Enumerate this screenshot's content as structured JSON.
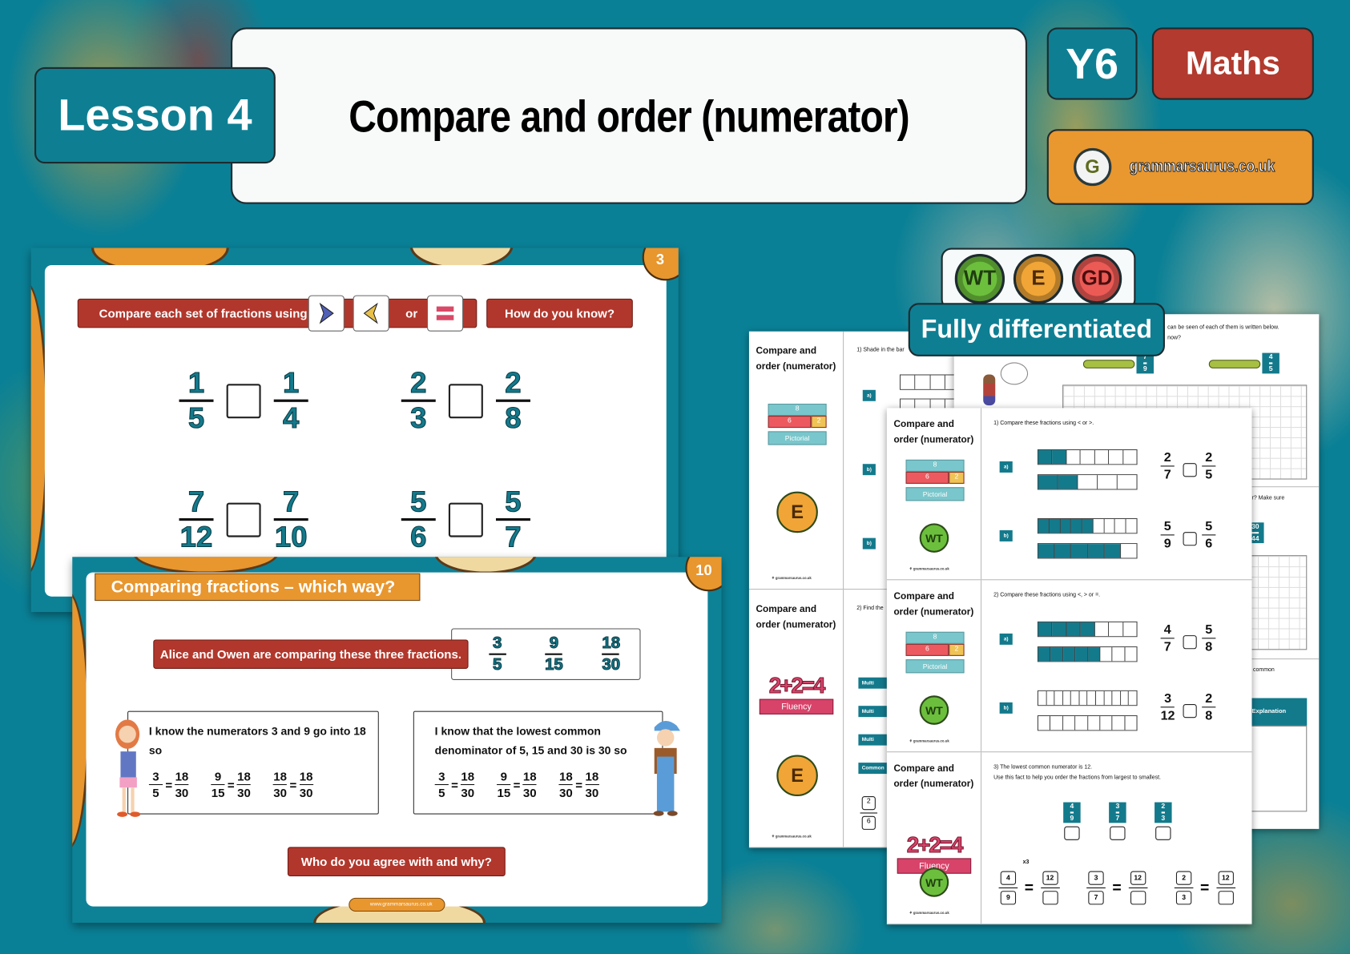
{
  "header": {
    "lesson": "Lesson 4",
    "title": "Compare and order (numerator)",
    "year": "Y6",
    "subject": "Maths",
    "brand": "grammarsaurus.co.uk"
  },
  "colors": {
    "teal": "#0d8297",
    "red": "#b1372c",
    "orange": "#e8962e",
    "white": "#ffffff",
    "wt": "#6cbf3c",
    "e": "#f0a536",
    "gd": "#ec5a55"
  },
  "slide3": {
    "number": "3",
    "instruction": "Compare each set of fractions using",
    "or": "or",
    "symbols": [
      "greater-than-icon",
      "less-than-icon",
      "equals-icon"
    ],
    "prompt": "How do you know?",
    "pairs": [
      {
        "a": [
          "1",
          "5"
        ],
        "b": [
          "1",
          "4"
        ]
      },
      {
        "a": [
          "2",
          "3"
        ],
        "b": [
          "2",
          "8"
        ]
      },
      {
        "a": [
          "7",
          "12"
        ],
        "b": [
          "7",
          "10"
        ]
      },
      {
        "a": [
          "5",
          "6"
        ],
        "b": [
          "5",
          "7"
        ]
      }
    ]
  },
  "slide10": {
    "number": "10",
    "title": "Comparing fractions – which way?",
    "banner": "Alice and Owen are comparing these three fractions.",
    "fractions": [
      [
        "3",
        "5"
      ],
      [
        "9",
        "15"
      ],
      [
        "18",
        "30"
      ]
    ],
    "alice": {
      "text": "I know the numerators 3 and 9 go into 18 so",
      "equations": [
        [
          [
            "3",
            "5"
          ],
          [
            "18",
            "30"
          ]
        ],
        [
          [
            "9",
            "15"
          ],
          [
            "18",
            "30"
          ]
        ],
        [
          [
            "18",
            "30"
          ],
          [
            "18",
            "30"
          ]
        ]
      ]
    },
    "owen": {
      "text": "I know that the lowest common denominator of 5, 15 and 30 is 30 so",
      "equations": [
        [
          [
            "3",
            "5"
          ],
          [
            "18",
            "30"
          ]
        ],
        [
          [
            "9",
            "15"
          ],
          [
            "18",
            "30"
          ]
        ],
        [
          [
            "18",
            "30"
          ],
          [
            "18",
            "30"
          ]
        ]
      ]
    },
    "question": "Who do you agree with and why?",
    "footer": "www.grammarsaurus.co.uk"
  },
  "badges": {
    "levels": [
      "WT",
      "E",
      "GD"
    ],
    "label": "Fully differentiated"
  },
  "worksheet_back_left": {
    "sections": [
      {
        "title": "Compare and order (numerator)",
        "model": {
          "total": "8",
          "parts": [
            "6",
            "2"
          ],
          "label": "Pictorial"
        },
        "level": "E",
        "question": "1) Shade in the bar",
        "labels": [
          "a)",
          "b)",
          "b)"
        ],
        "footer": "grammarsaurus.co.uk"
      },
      {
        "title": "Compare and order (numerator)",
        "fluency": {
          "equation": "2+2=4",
          "label": "Fluency"
        },
        "level": "E",
        "question": "2) Find the",
        "buttons": [
          "Multi",
          "Multi",
          "Multi",
          "Common"
        ],
        "fraction": [
          "2",
          "6"
        ],
        "footer": "grammarsaurus.co.uk"
      }
    ]
  },
  "worksheet_back_right": {
    "line1": "can be seen of each of them is written below.",
    "line2": "now?",
    "snake_fractions": [
      [
        "7",
        "9"
      ],
      [
        "4",
        "5"
      ]
    ],
    "line3": "r? Make sure",
    "card": [
      "30",
      "44"
    ],
    "line4": "e common",
    "table_header": "Explanation"
  },
  "worksheet_front": {
    "sections": [
      {
        "title": "Compare and order (numerator)",
        "model": {
          "total": "8",
          "parts": [
            "6",
            "2"
          ],
          "label": "Pictorial"
        },
        "level": "WT",
        "footer": "grammarsaurus.co.uk",
        "question": "1) Compare these fractions using < or >.",
        "items": [
          {
            "label": "a)",
            "bars": [
              {
                "parts": 7,
                "shaded": 2
              },
              {
                "parts": 5,
                "shaded": 2
              }
            ],
            "a": [
              "2",
              "7"
            ],
            "b": [
              "2",
              "5"
            ]
          },
          {
            "label": "b)",
            "bars": [
              {
                "parts": 9,
                "shaded": 5
              },
              {
                "parts": 6,
                "shaded": 5
              }
            ],
            "a": [
              "5",
              "9"
            ],
            "b": [
              "5",
              "6"
            ]
          }
        ]
      },
      {
        "title": "Compare and order (numerator)",
        "model": {
          "total": "8",
          "parts": [
            "6",
            "2"
          ],
          "label": "Pictorial"
        },
        "level": "WT",
        "footer": "grammarsaurus.co.uk",
        "question": "2) Compare these fractions using <, > or =.",
        "items": [
          {
            "label": "a)",
            "bars": [
              {
                "parts": 7,
                "shaded": 4
              },
              {
                "parts": 8,
                "shaded": 5
              }
            ],
            "a": [
              "4",
              "7"
            ],
            "b": [
              "5",
              "8"
            ]
          },
          {
            "label": "b)",
            "bars": [
              {
                "parts": 12,
                "shaded": 0
              },
              {
                "parts": 8,
                "shaded": 0
              }
            ],
            "a": [
              "3",
              "12"
            ],
            "b": [
              "2",
              "8"
            ]
          }
        ]
      },
      {
        "title": "Compare and order (numerator)",
        "fluency": {
          "equation": "2+2=4",
          "label": "Fluency"
        },
        "level": "WT",
        "footer": "grammarsaurus.co.uk",
        "question": "3) The lowest common numerator is 12.",
        "question2": "Use this fact to help you order the fractions from largest to smallest.",
        "cards": [
          [
            "4",
            "9"
          ],
          [
            "3",
            "7"
          ],
          [
            "2",
            "3"
          ]
        ],
        "multiplier": "x3",
        "equations": [
          {
            "a": [
              "4",
              "9"
            ],
            "b": [
              "12",
              ""
            ]
          },
          {
            "a": [
              "3",
              "7"
            ],
            "b": [
              "12",
              ""
            ]
          },
          {
            "a": [
              "2",
              "3"
            ],
            "b": [
              "12",
              ""
            ]
          }
        ]
      }
    ]
  }
}
